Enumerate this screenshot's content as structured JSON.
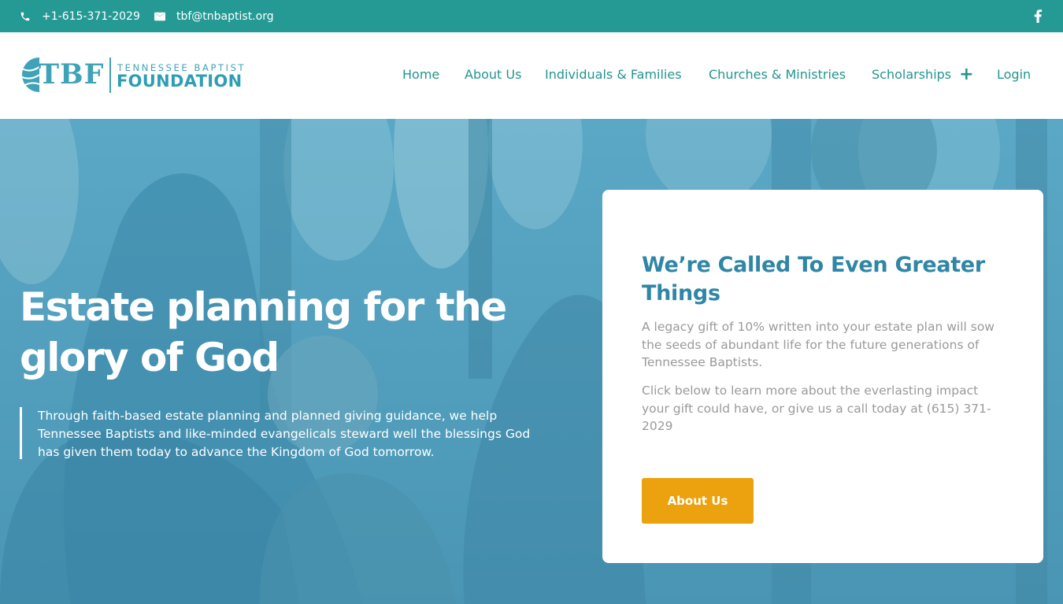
{
  "topbar": {
    "phone": "+1-615-371-2029",
    "email": "tbf@tnbaptist.org",
    "social_icon": "facebook-icon"
  },
  "logo": {
    "initials": "TBF",
    "line1": "TENNESSEE BAPTIST",
    "line2": "FOUNDATION"
  },
  "nav": {
    "items": [
      {
        "label": "Home"
      },
      {
        "label": "About Us"
      },
      {
        "label": "Individuals & Families"
      },
      {
        "label": "Churches & Ministries"
      },
      {
        "label": "Scholarships"
      },
      {
        "label": "Login"
      }
    ],
    "expand_symbol": "+"
  },
  "hero": {
    "title": "Estate planning for the glory of God",
    "quote": "Through faith-based estate planning and planned giving guidance, we help Tennessee Baptists and like-minded evangelicals steward well the blessings God has given them today to advance the Kingdom of God tomorrow."
  },
  "card": {
    "title": "We’re Called To Even Greater Things",
    "paragraph1": "A legacy gift of 10% written into your estate plan will sow the seeds of abundant life for the future generations of Tennessee Baptists.",
    "paragraph2": "Click below to learn more about the everlasting impact your gift could have, or give us a call today at (615) 371-2029",
    "button_label": "About Us"
  },
  "colors": {
    "topbar": "#259a95",
    "nav_text": "#22958f",
    "card_title": "#2f86a6",
    "button": "#eba20e",
    "hero_overlay": "#4f9dbb"
  }
}
